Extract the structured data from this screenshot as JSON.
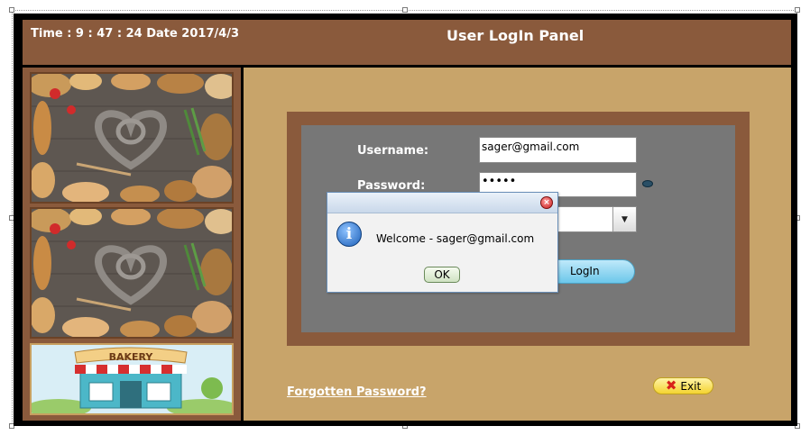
{
  "header": {
    "time_text": "Time : 9 : 47 : 24 Date 2017/4/3",
    "title": "User LogIn Panel"
  },
  "sidebar": {
    "images": [
      "bread-heart-image",
      "bread-heart-image",
      "bakery-shop-image"
    ],
    "bakery_sign": "BAKERY"
  },
  "form": {
    "username_label": "Username:",
    "username_value": "sager@gmail.com",
    "password_label": "Password:",
    "password_value": "•••••",
    "login_label": "LogIn"
  },
  "footer": {
    "forgot_link": "Forgotten Password?",
    "exit_label": "Exit"
  },
  "dialog": {
    "message": "Welcome - sager@gmail.com",
    "ok_label": "OK"
  },
  "colors": {
    "brown": "#8a5a3c",
    "tan": "#c8a46a",
    "gray_panel": "#777777",
    "login_blue": "#6cc7ea",
    "exit_yellow": "#f4d32f"
  }
}
